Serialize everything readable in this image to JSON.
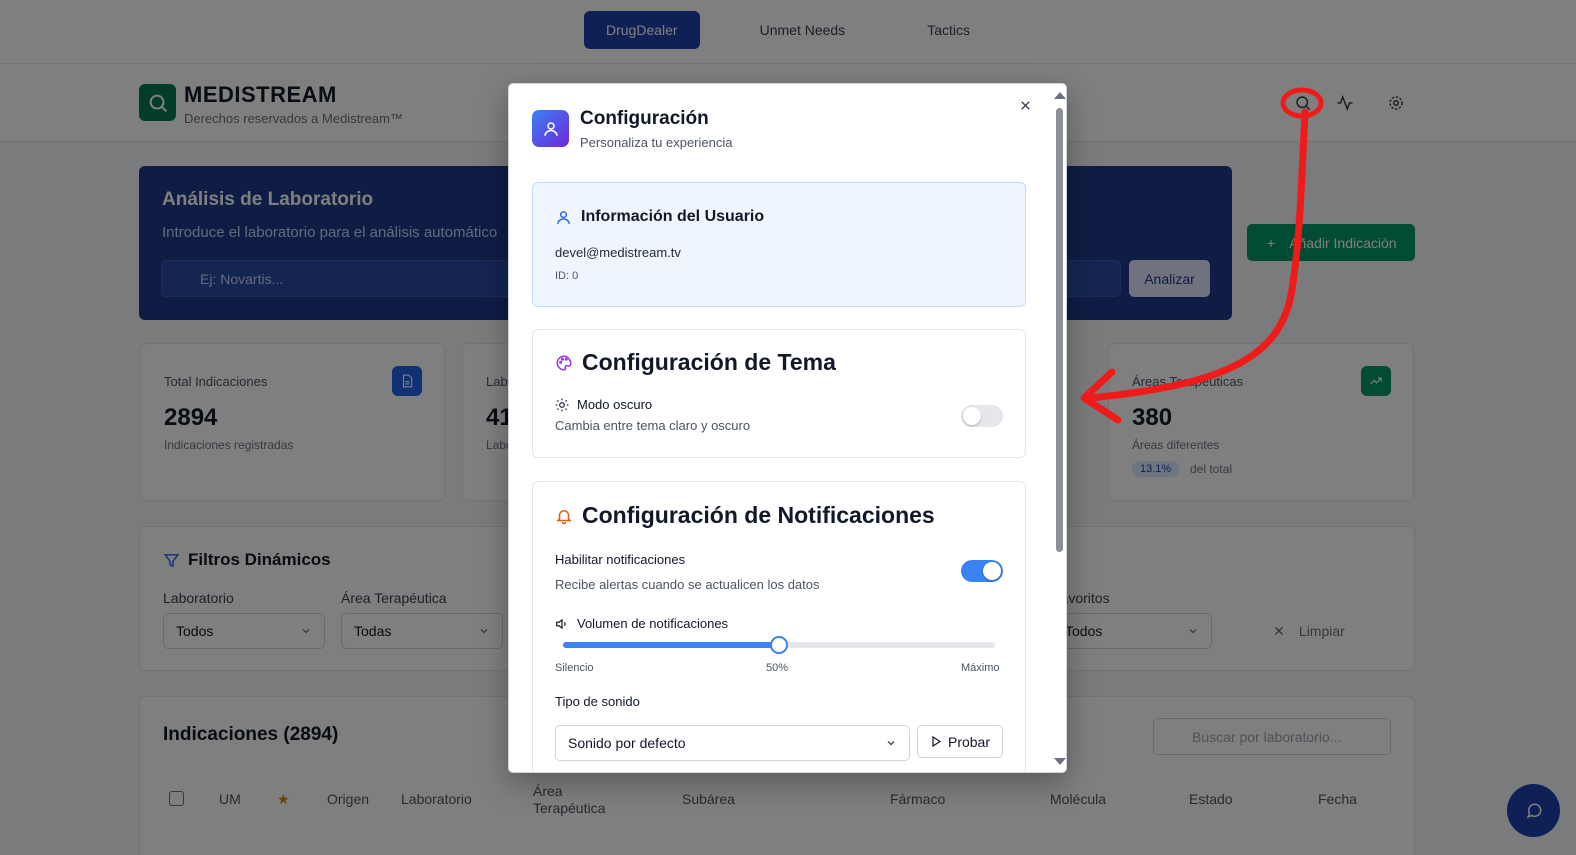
{
  "topnav": {
    "tabs": [
      {
        "label": "DrugDealer",
        "active": true
      },
      {
        "label": "Unmet Needs"
      },
      {
        "label": "Tactics"
      }
    ]
  },
  "header": {
    "brand": "MEDISTREAM",
    "subtitle": "Derechos reservados a Medistream™",
    "icons": [
      "search-icon",
      "activity-icon",
      "gear-icon"
    ]
  },
  "hero": {
    "title": "Análisis de Laboratorio",
    "subtitle": "Introduce el laboratorio para el análisis automático",
    "placeholder": "Ej: Novartis...",
    "button": "Analizar"
  },
  "add_button": "Añadir Indicación",
  "stats": [
    {
      "label": "Total Indicaciones",
      "value": "2894",
      "sub": "Indicaciones registradas",
      "icon": "document-icon"
    },
    {
      "label": "Laboratorios",
      "value": "41",
      "sub": "Laboratorios únicos",
      "icon": "flask-icon"
    },
    {
      "label": "Áreas Terapéuticas",
      "value": "380",
      "sub": "Áreas diferentes",
      "badge": "13.1%",
      "badge_sub": "del total",
      "icon": "trending-up-icon"
    }
  ],
  "filters": {
    "title": "Filtros Dinámicos",
    "fields": [
      {
        "label": "Laboratorio",
        "value": "Todos"
      },
      {
        "label": "Área Terapéutica",
        "value": "Todas"
      },
      {
        "label": "Favoritos",
        "value": "Todos"
      }
    ],
    "clear": "Limpiar"
  },
  "table": {
    "title": "Indicaciones (2894)",
    "search_placeholder": "Buscar por laboratorio...",
    "columns": [
      "UM",
      "Origen",
      "Laboratorio",
      "Área Terapéutica",
      "Subárea",
      "Fármaco",
      "Molécula",
      "Estado",
      "Fecha"
    ]
  },
  "modal": {
    "title": "Configuración",
    "subtitle": "Personaliza tu experiencia",
    "user_section": {
      "title": "Información del Usuario",
      "email": "devel@medistream.tv",
      "id": "ID: 0"
    },
    "theme_section": {
      "title": "Configuración de Tema",
      "option_title": "Modo oscuro",
      "option_desc": "Cambia entre tema claro y oscuro",
      "enabled": false
    },
    "notif_section": {
      "title": "Configuración de Notificaciones",
      "enable_title": "Habilitar notificaciones",
      "enable_desc": "Recibe alertas cuando se actualicen los datos",
      "enabled": true,
      "volume_title": "Volumen de notificaciones",
      "volume_value": 0.5,
      "volume_min_label": "Silencio",
      "volume_current_label": "50%",
      "volume_max_label": "Máximo",
      "sound_type_title": "Tipo de sonido",
      "sound_type_value": "Sonido por defecto",
      "test_button": "Probar"
    }
  },
  "colors": {
    "accent": "#3b82f6",
    "brand_green": "#047857",
    "annotation_red": "#ef1b1b"
  }
}
